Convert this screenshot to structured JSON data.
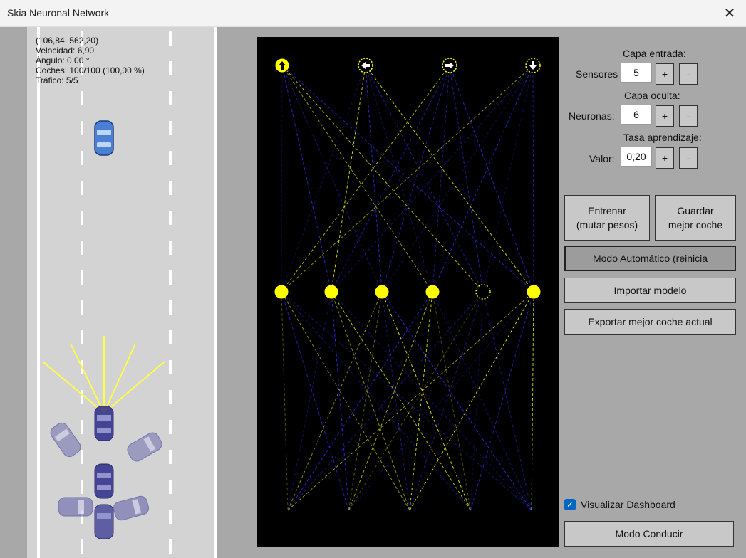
{
  "window": {
    "title": "Skia Neuronal Network",
    "close_glyph": "✕"
  },
  "hud": {
    "position": "(106,84, 562,20)",
    "velocidad": "Velocidad: 6,90",
    "angulo": "Ángulo: 0,00 °",
    "coches": "Coches: 100/100 (100,00 %)",
    "trafico": "Tráfico: 5/5"
  },
  "controls": {
    "input_layer_title": "Capa entrada:",
    "sensors_label": "Sensores",
    "sensors_value": "5",
    "hidden_layer_title": "Capa oculta:",
    "neurons_label": "Neuronas:",
    "neurons_value": "6",
    "learning_rate_title": "Tasa aprendizaje:",
    "rate_label": "Valor:",
    "rate_value": "0,20",
    "plus": "+",
    "minus": "-"
  },
  "buttons": {
    "train_line1": "Entrenar",
    "train_line2": "(mutar pesos)",
    "save_line1": "Guardar",
    "save_line2": "mejor coche",
    "auto_mode": "Modo Automático (reinicia",
    "import_model": "Importar modelo",
    "export_best": "Exportar mejor coche actual",
    "drive_mode": "Modo Conducir"
  },
  "dashboard": {
    "label": "Visualizar Dashboard",
    "checked": true
  },
  "network": {
    "output_icons": [
      "arrow-up-icon",
      "arrow-left-icon",
      "arrow-right-icon",
      "arrow-down-icon"
    ],
    "output_active": [
      true,
      false,
      false,
      false
    ],
    "hidden_active": [
      true,
      true,
      true,
      true,
      false,
      true
    ],
    "input_count": 5
  },
  "colors": {
    "neuron": "#ffff00",
    "positive_weight": "#ffff00",
    "negative_weight": "#3333ff",
    "panel_bg": "#000000",
    "car_main": "#4a7fd4",
    "car_ghost": "#2a2a8a"
  }
}
